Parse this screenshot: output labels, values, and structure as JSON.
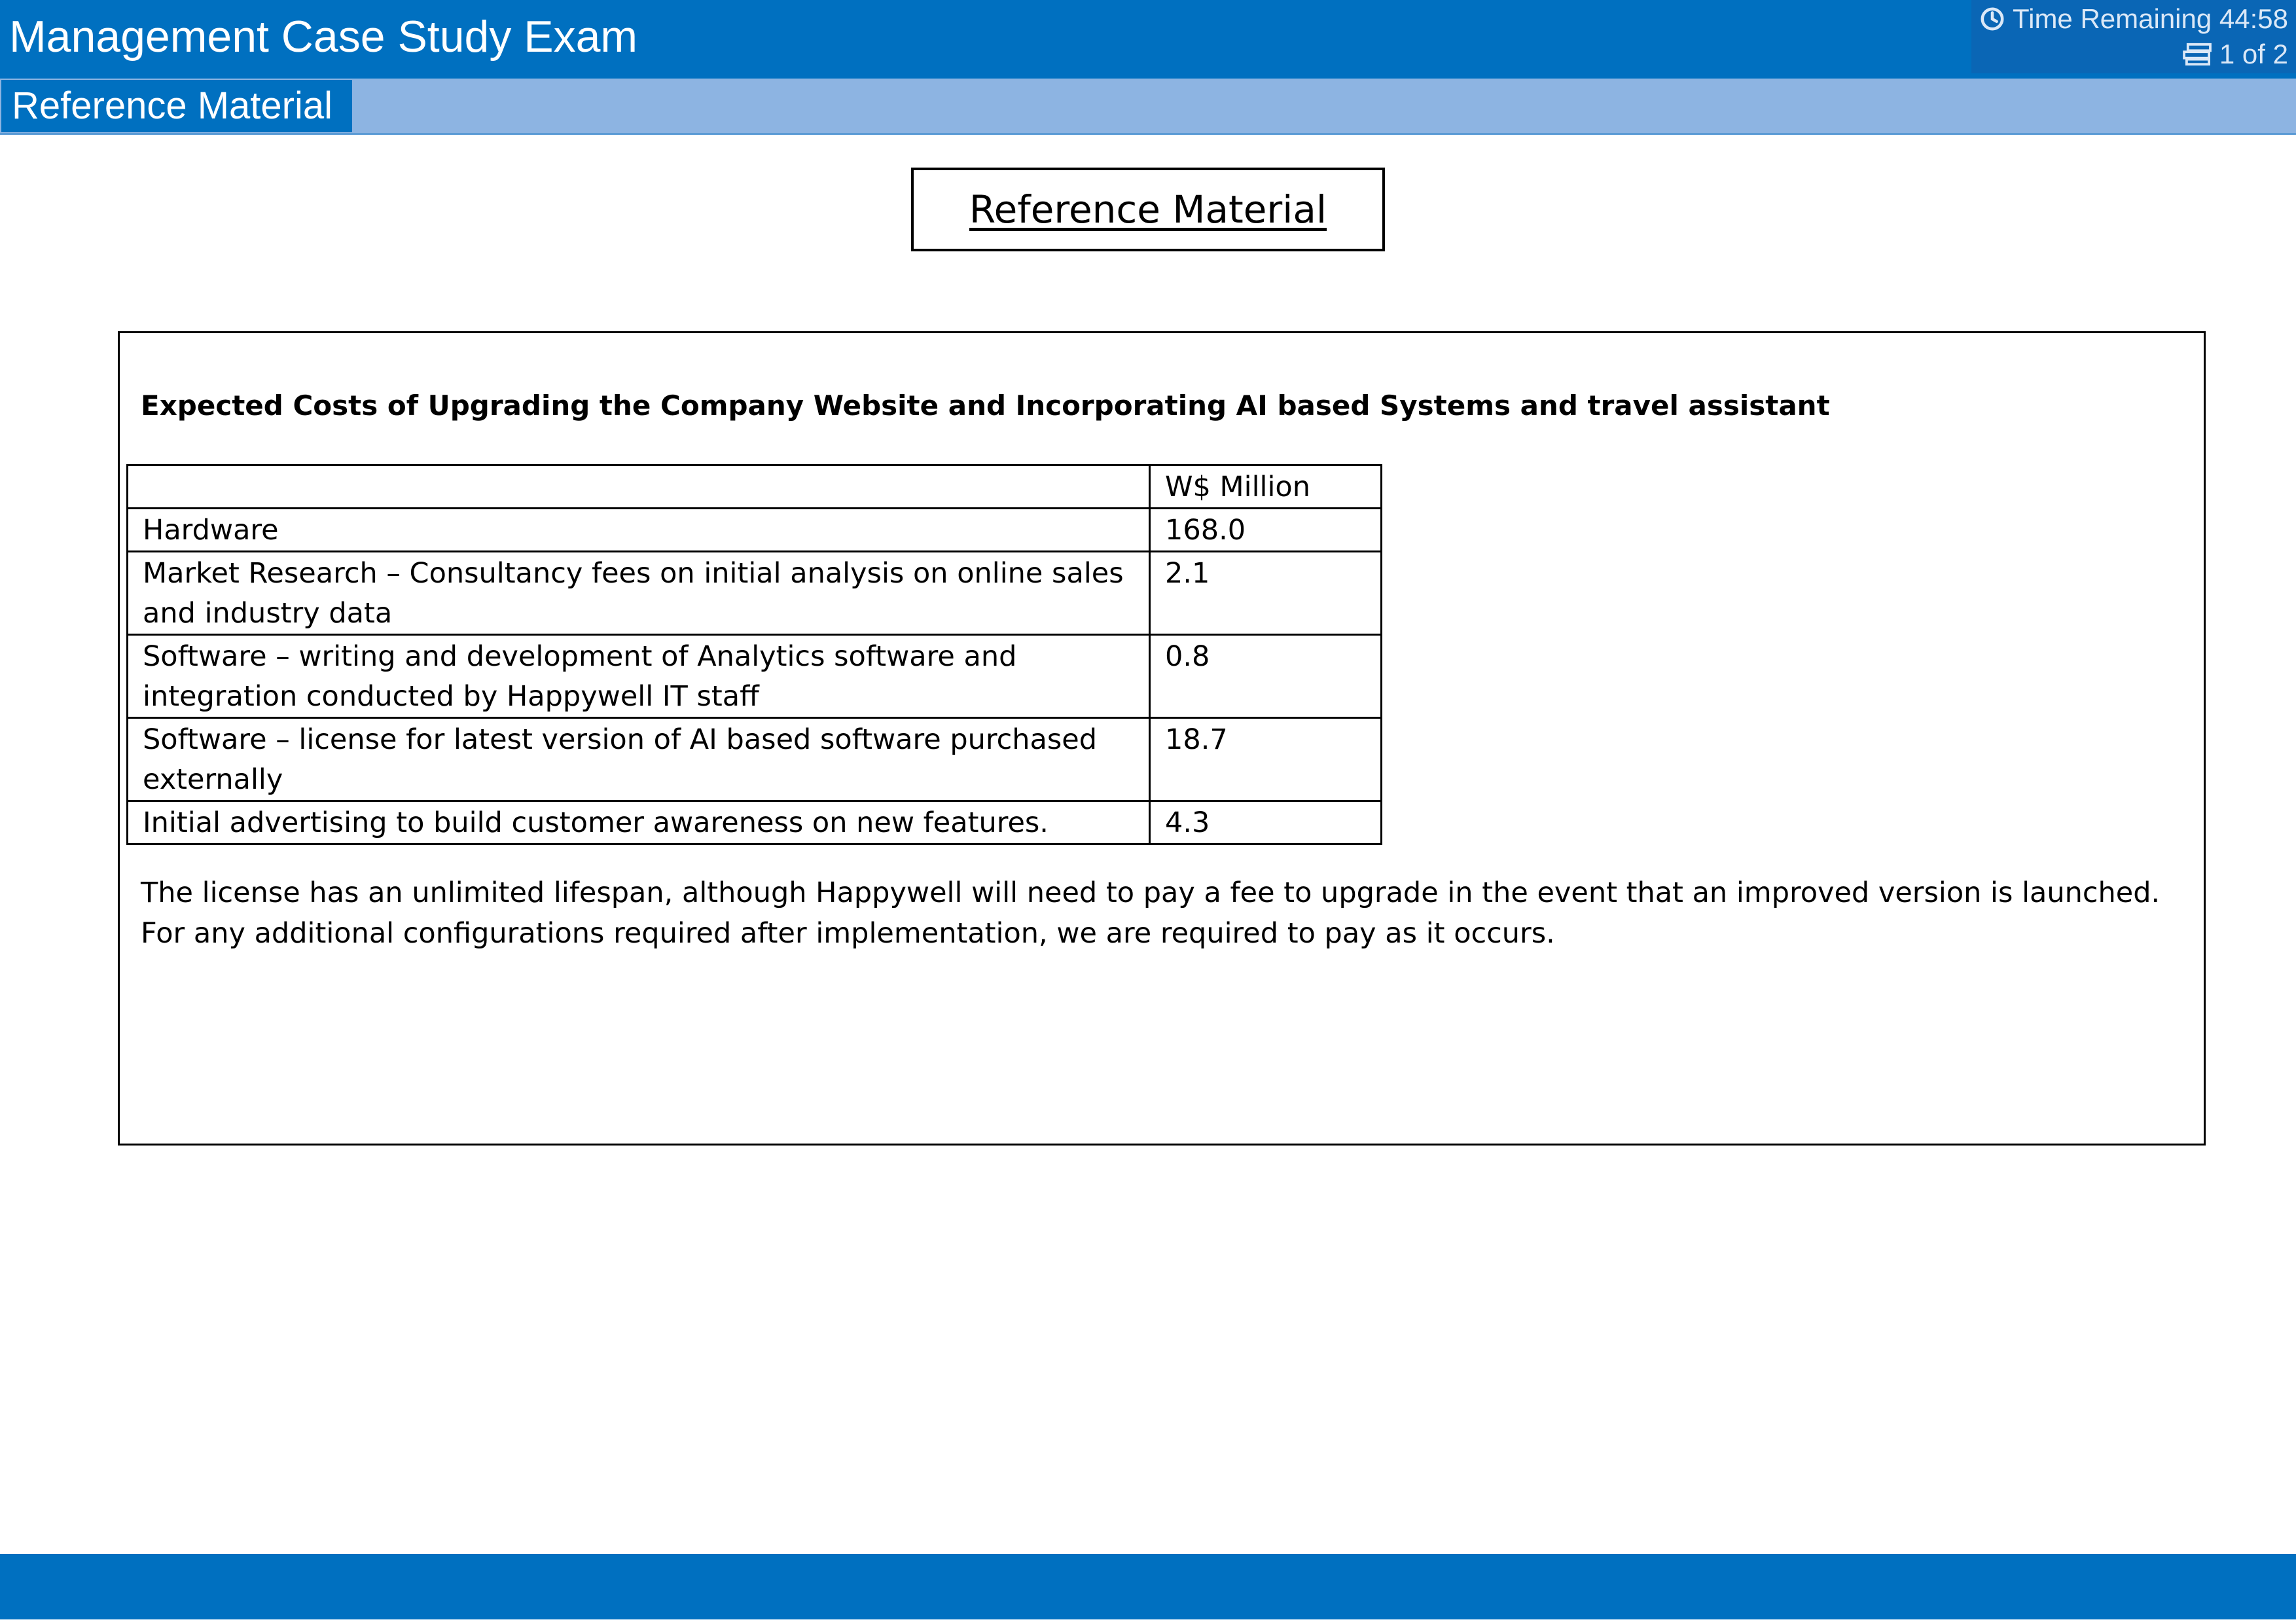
{
  "header": {
    "title": "Management Case Study Exam",
    "timer_label": "Time Remaining 44:58",
    "page_indicator": "1 of 2"
  },
  "tabs": [
    {
      "label": "Reference Material",
      "active": true
    }
  ],
  "reference": {
    "title": "Reference Material",
    "heading": "Expected Costs of Upgrading the Company Website and Incorporating AI based Systems and travel assistant",
    "table": {
      "header": [
        "",
        "W$ Million"
      ],
      "rows": [
        {
          "item": "Hardware",
          "value": "168.0"
        },
        {
          "item": "Market Research – Consultancy fees on initial analysis on online sales and industry data",
          "value": "2.1"
        },
        {
          "item": "Software – writing and development of Analytics software and integration conducted by Happywell IT staff",
          "value": "0.8"
        },
        {
          "item": "Software – license for latest version of AI based software purchased externally",
          "value": "18.7"
        },
        {
          "item": "Initial advertising to build customer awareness on new features.",
          "value": "4.3"
        }
      ]
    },
    "note": "The license has an unlimited lifespan, although Happywell will need to pay a fee to upgrade in the event that an improved version is launched. For any additional configurations required after implementation, we are required to pay as it occurs."
  },
  "icons": {
    "timer": "clock-icon",
    "pages": "pages-icon"
  },
  "colors": {
    "header": "#0070c0",
    "tab_strip": "#8db4e2",
    "footer": "#0070c0",
    "status_text": "#dbe8f7"
  }
}
